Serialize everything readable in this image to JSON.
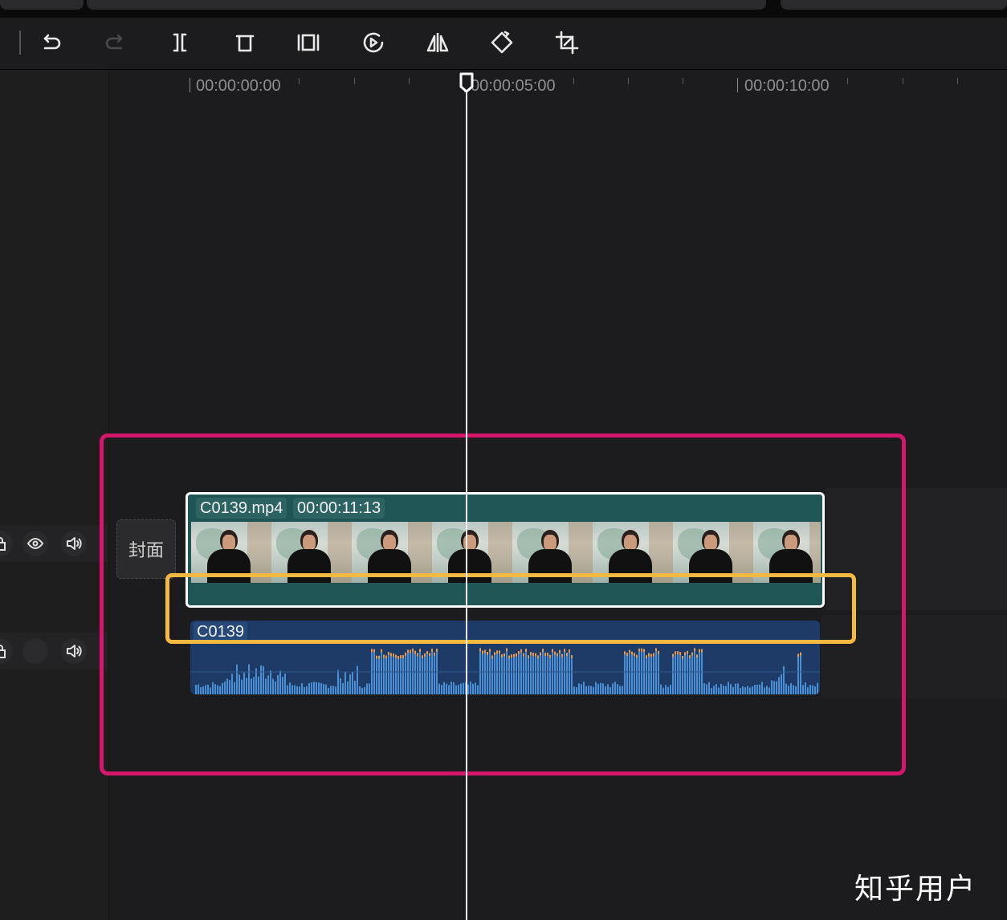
{
  "toolbar": {
    "icons": [
      "undo-icon",
      "redo-icon",
      "split-icon",
      "delete-icon",
      "freeze-frame-icon",
      "speed-icon",
      "mirror-icon",
      "rotate-icon",
      "crop-icon"
    ]
  },
  "ruler": {
    "labels": [
      "00:00:00:00",
      "00:00:05:00",
      "00:00:10:00"
    ]
  },
  "tracks": {
    "cover_label": "封面",
    "video": {
      "filename": "C0139.mp4",
      "duration": "00:00:11:13"
    },
    "audio": {
      "name": "C0139"
    }
  },
  "colors": {
    "highlight_outer": "#d4176a",
    "highlight_inner": "#f5b942",
    "video_clip": "#1f5554",
    "audio_clip": "#1d3b66",
    "waveform": "#4a8fd4"
  },
  "watermark": "知乎用户"
}
